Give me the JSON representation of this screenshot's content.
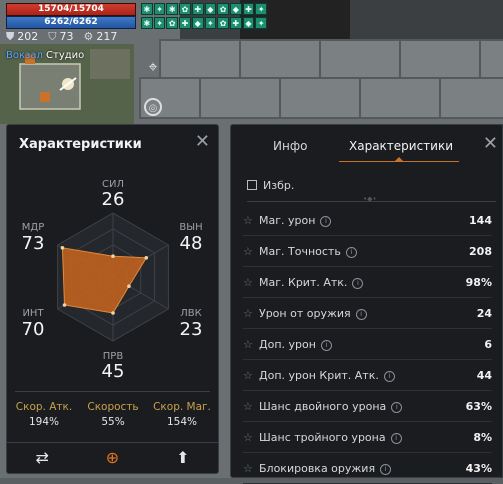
{
  "hud": {
    "hp": "15704/15704",
    "mp": "6262/6262",
    "buffs_row1": [
      "✱",
      "✦",
      "✱",
      "✿",
      "✚",
      "◆",
      "✿",
      "◆",
      "✚",
      "✦",
      "⚑"
    ],
    "buffs_row2": [
      "✱",
      "✦",
      "✿",
      "✚",
      "◆",
      "✦",
      "✿",
      "✚",
      "◆",
      "✦",
      "✱"
    ],
    "stat_a_icon": "shield-icon",
    "stat_a": "202",
    "stat_b_icon": "shield-icon",
    "stat_b": "73",
    "stat_c_icon": "gear-icon",
    "stat_c": "217",
    "minimap_label_a": "Вокзал",
    "minimap_label_b": "Студио"
  },
  "left_panel": {
    "title": "Характеристики",
    "radar": {
      "axes": [
        {
          "label": "СИЛ",
          "value": "26"
        },
        {
          "label": "ВЫН",
          "value": "48"
        },
        {
          "label": "ЛВК",
          "value": "23"
        },
        {
          "label": "ПРВ",
          "value": "45"
        },
        {
          "label": "ИНТ",
          "value": "70"
        },
        {
          "label": "МДР",
          "value": "73"
        }
      ]
    },
    "speeds": [
      {
        "label": "Скор. Атк.",
        "value": "194%"
      },
      {
        "label": "Скорость",
        "value": "55%"
      },
      {
        "label": "Скор. Маг.",
        "value": "154%"
      }
    ]
  },
  "right_panel": {
    "tabs": [
      "Инфо",
      "Характеристики"
    ],
    "favorites_label": "Избр.",
    "stats": [
      {
        "name": "Маг. урон",
        "value": "144"
      },
      {
        "name": "Маг. Точность",
        "value": "208"
      },
      {
        "name": "Маг. Крит. Атк.",
        "value": "98%"
      },
      {
        "name": "Урон от оружия",
        "value": "24"
      },
      {
        "name": "Доп. урон",
        "value": "6"
      },
      {
        "name": "Доп. урон Крит. Атк.",
        "value": "44"
      },
      {
        "name": "Шанс двойного урона",
        "value": "63%"
      },
      {
        "name": "Шанс тройного урона",
        "value": "8%"
      },
      {
        "name": "Блокировка оружия",
        "value": "43%"
      }
    ]
  },
  "colors": {
    "accent": "#e3751f",
    "hp": "#c0392b",
    "mp": "#2f6cc0",
    "buff": "#1d8f6f",
    "radar_fill": "#c0621f"
  }
}
